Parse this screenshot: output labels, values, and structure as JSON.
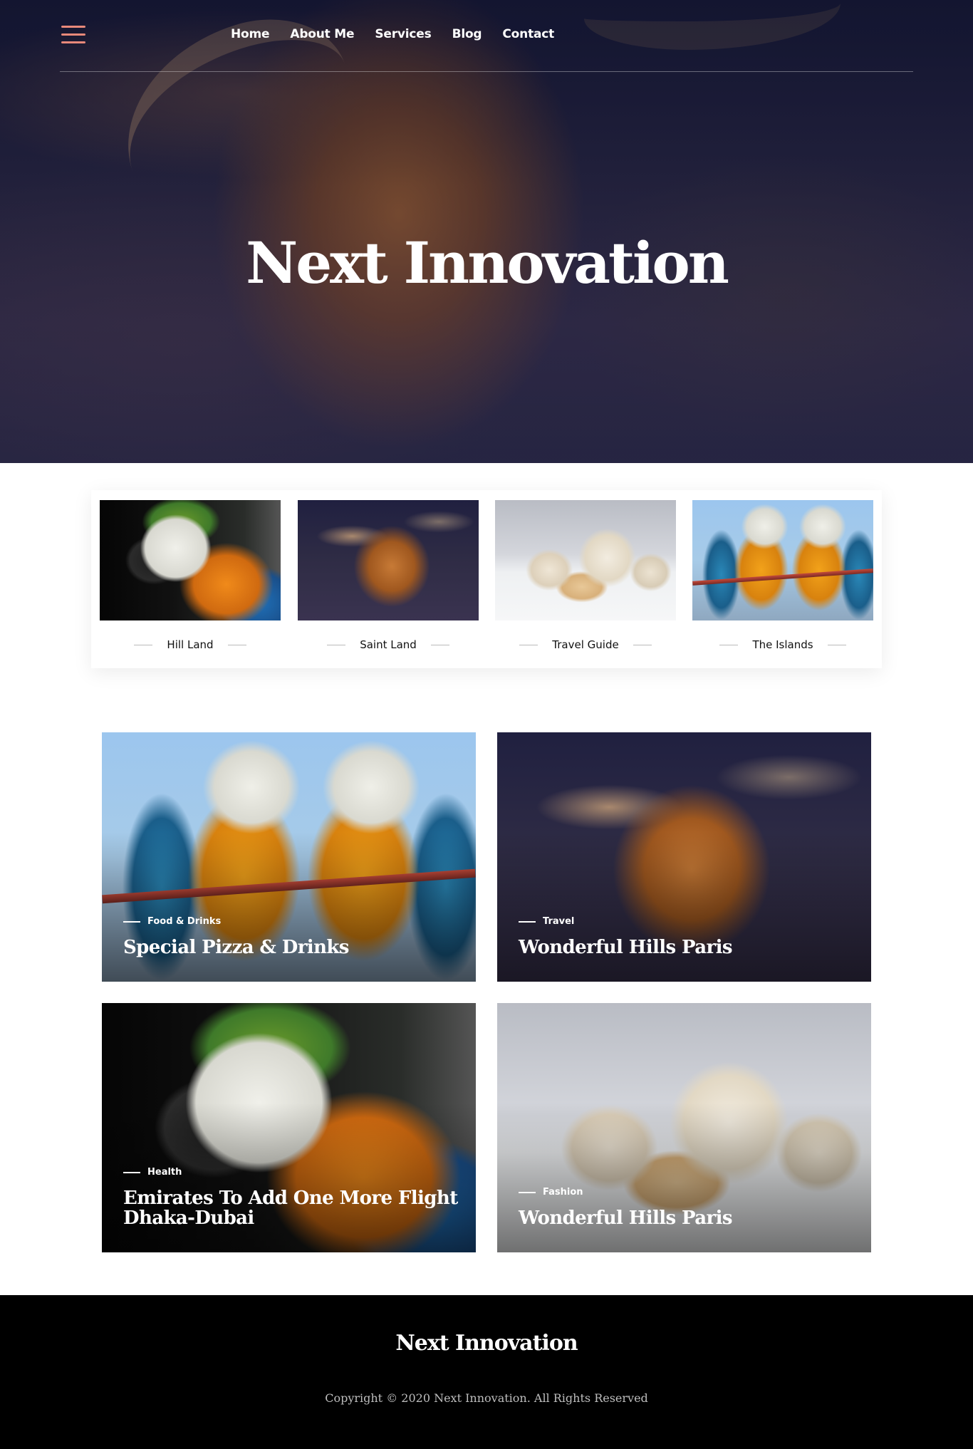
{
  "nav": {
    "items": [
      "Home",
      "About Me",
      "Services",
      "Blog",
      "Contact"
    ]
  },
  "hero": {
    "title": "Next Innovation"
  },
  "categories": [
    {
      "label": "Hill Land"
    },
    {
      "label": "Saint Land"
    },
    {
      "label": "Travel Guide"
    },
    {
      "label": "The Islands"
    }
  ],
  "posts": [
    {
      "category": "Food & Drinks",
      "title": "Special Pizza & Drinks"
    },
    {
      "category": "Travel",
      "title": "Wonderful Hills Paris"
    },
    {
      "category": "Health",
      "title": "Emirates To Add One More Flight Dhaka-Dubai"
    },
    {
      "category": "Fashion",
      "title": "Wonderful Hills Paris"
    }
  ],
  "footer": {
    "brand": "Next Innovation",
    "copyright": "Copyright © 2020 Next Innovation. All Rights Reserved"
  },
  "colors": {
    "accent": "#e8897a",
    "footer_bg": "#000000"
  },
  "icons": {
    "menu": "hamburger-menu-icon"
  }
}
